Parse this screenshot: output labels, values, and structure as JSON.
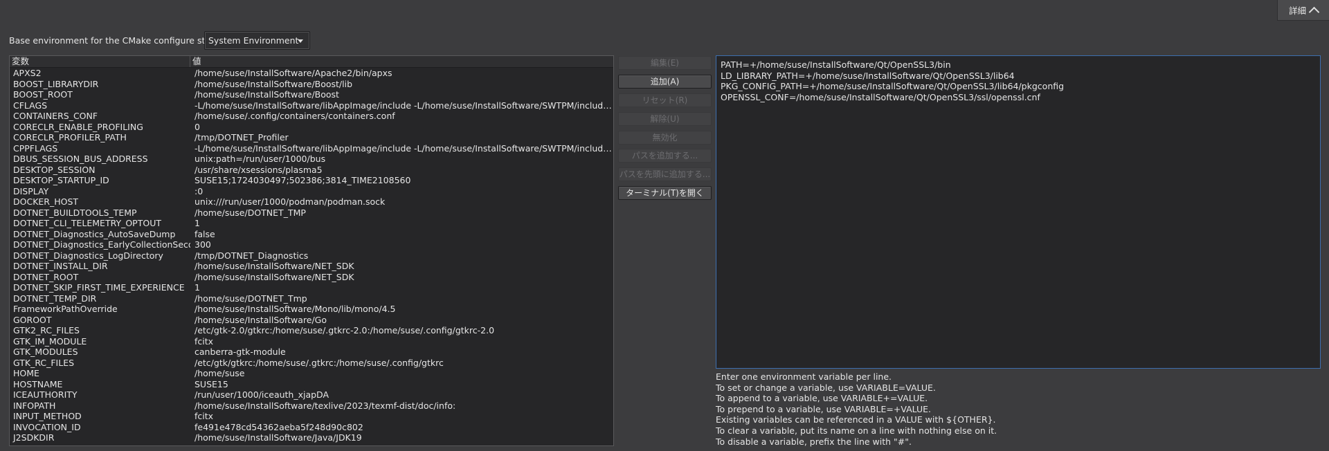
{
  "details_button": {
    "label": "詳細"
  },
  "base_env": {
    "label": "Base environment for the CMake configure step:",
    "value": "System Environment"
  },
  "table": {
    "headers": [
      "変数",
      "値"
    ],
    "rows": [
      [
        "APXS2",
        "/home/suse/InstallSoftware/Apache2/bin/apxs"
      ],
      [
        "BOOST_LIBRARYDIR",
        "/home/suse/InstallSoftware/Boost/lib"
      ],
      [
        "BOOST_ROOT",
        "/home/suse/InstallSoftware/Boost"
      ],
      [
        "CFLAGS",
        "-L/home/suse/InstallSoftware/libAppImage/include -L/home/suse/InstallSoftware/SWTPM/include -L/ho..."
      ],
      [
        "CONTAINERS_CONF",
        "/home/suse/.config/containers/containers.conf"
      ],
      [
        "CORECLR_ENABLE_PROFILING",
        "0"
      ],
      [
        "CORECLR_PROFILER_PATH",
        "/tmp/DOTNET_Profiler"
      ],
      [
        "CPPFLAGS",
        "-L/home/suse/InstallSoftware/libAppImage/include -L/home/suse/InstallSoftware/SWTPM/include -L/ho..."
      ],
      [
        "DBUS_SESSION_BUS_ADDRESS",
        "unix:path=/run/user/1000/bus"
      ],
      [
        "DESKTOP_SESSION",
        "/usr/share/xsessions/plasma5"
      ],
      [
        "DESKTOP_STARTUP_ID",
        "SUSE15;1724030497;502386;3814_TIME2108560"
      ],
      [
        "DISPLAY",
        ":0"
      ],
      [
        "DOCKER_HOST",
        "unix:///run/user/1000/podman/podman.sock"
      ],
      [
        "DOTNET_BUILDTOOLS_TEMP",
        "/home/suse/DOTNET_TMP"
      ],
      [
        "DOTNET_CLI_TELEMETRY_OPTOUT",
        "1"
      ],
      [
        "DOTNET_Diagnostics_AutoSaveDump",
        "false"
      ],
      [
        "DOTNET_Diagnostics_EarlyCollectionSeconds",
        "300"
      ],
      [
        "DOTNET_Diagnostics_LogDirectory",
        "/tmp/DOTNET_Diagnostics"
      ],
      [
        "DOTNET_INSTALL_DIR",
        "/home/suse/InstallSoftware/NET_SDK"
      ],
      [
        "DOTNET_ROOT",
        "/home/suse/InstallSoftware/NET_SDK"
      ],
      [
        "DOTNET_SKIP_FIRST_TIME_EXPERIENCE",
        "1"
      ],
      [
        "DOTNET_TEMP_DIR",
        "/home/suse/DOTNET_Tmp"
      ],
      [
        "FrameworkPathOverride",
        "/home/suse/InstallSoftware/Mono/lib/mono/4.5"
      ],
      [
        "GOROOT",
        "/home/suse/InstallSoftware/Go"
      ],
      [
        "GTK2_RC_FILES",
        "/etc/gtk-2.0/gtkrc:/home/suse/.gtkrc-2.0:/home/suse/.config/gtkrc-2.0"
      ],
      [
        "GTK_IM_MODULE",
        "fcitx"
      ],
      [
        "GTK_MODULES",
        "canberra-gtk-module"
      ],
      [
        "GTK_RC_FILES",
        "/etc/gtk/gtkrc:/home/suse/.gtkrc:/home/suse/.config/gtkrc"
      ],
      [
        "HOME",
        "/home/suse"
      ],
      [
        "HOSTNAME",
        "SUSE15"
      ],
      [
        "ICEAUTHORITY",
        "/run/user/1000/iceauth_xjapDA"
      ],
      [
        "INFOPATH",
        "/home/suse/InstallSoftware/texlive/2023/texmf-dist/doc/info:"
      ],
      [
        "INPUT_METHOD",
        "fcitx"
      ],
      [
        "INVOCATION_ID",
        "fe491e478cd54362aeba5f248d90c802"
      ],
      [
        "J2SDKDIR",
        "/home/suse/InstallSoftware/Java/JDK19"
      ]
    ]
  },
  "buttons": [
    {
      "label": "編集(E)",
      "enabled": false
    },
    {
      "label": "追加(A)",
      "enabled": true
    },
    {
      "label": "リセット(R)",
      "enabled": false
    },
    {
      "label": "解除(U)",
      "enabled": false
    },
    {
      "label": "無効化",
      "enabled": false
    },
    {
      "label": "パスを追加する...",
      "enabled": false
    },
    {
      "label": "パスを先頭に追加する...",
      "enabled": false
    },
    {
      "label": "ターミナル(T)を開く",
      "enabled": true
    }
  ],
  "editor_lines": [
    "PATH=+/home/suse/InstallSoftware/Qt/OpenSSL3/bin",
    "LD_LIBRARY_PATH=+/home/suse/InstallSoftware/Qt/OpenSSL3/lib64",
    "PKG_CONFIG_PATH=+/home/suse/InstallSoftware/Qt/OpenSSL3/lib64/pkgconfig",
    "OPENSSL_CONF=/home/suse/InstallSoftware/Qt/OpenSSL3/ssl/openssl.cnf"
  ],
  "help_lines": [
    "Enter one environment variable per line.",
    "To set or change a variable, use VARIABLE=VALUE.",
    "To append to a variable, use VARIABLE+=VALUE.",
    "To prepend to a variable, use VARIABLE=+VALUE.",
    "Existing variables can be referenced in a VALUE with ${OTHER}.",
    "To clear a variable, put its name on a line with nothing else on it.",
    "To disable a variable, prefix the line with \"#\"."
  ]
}
